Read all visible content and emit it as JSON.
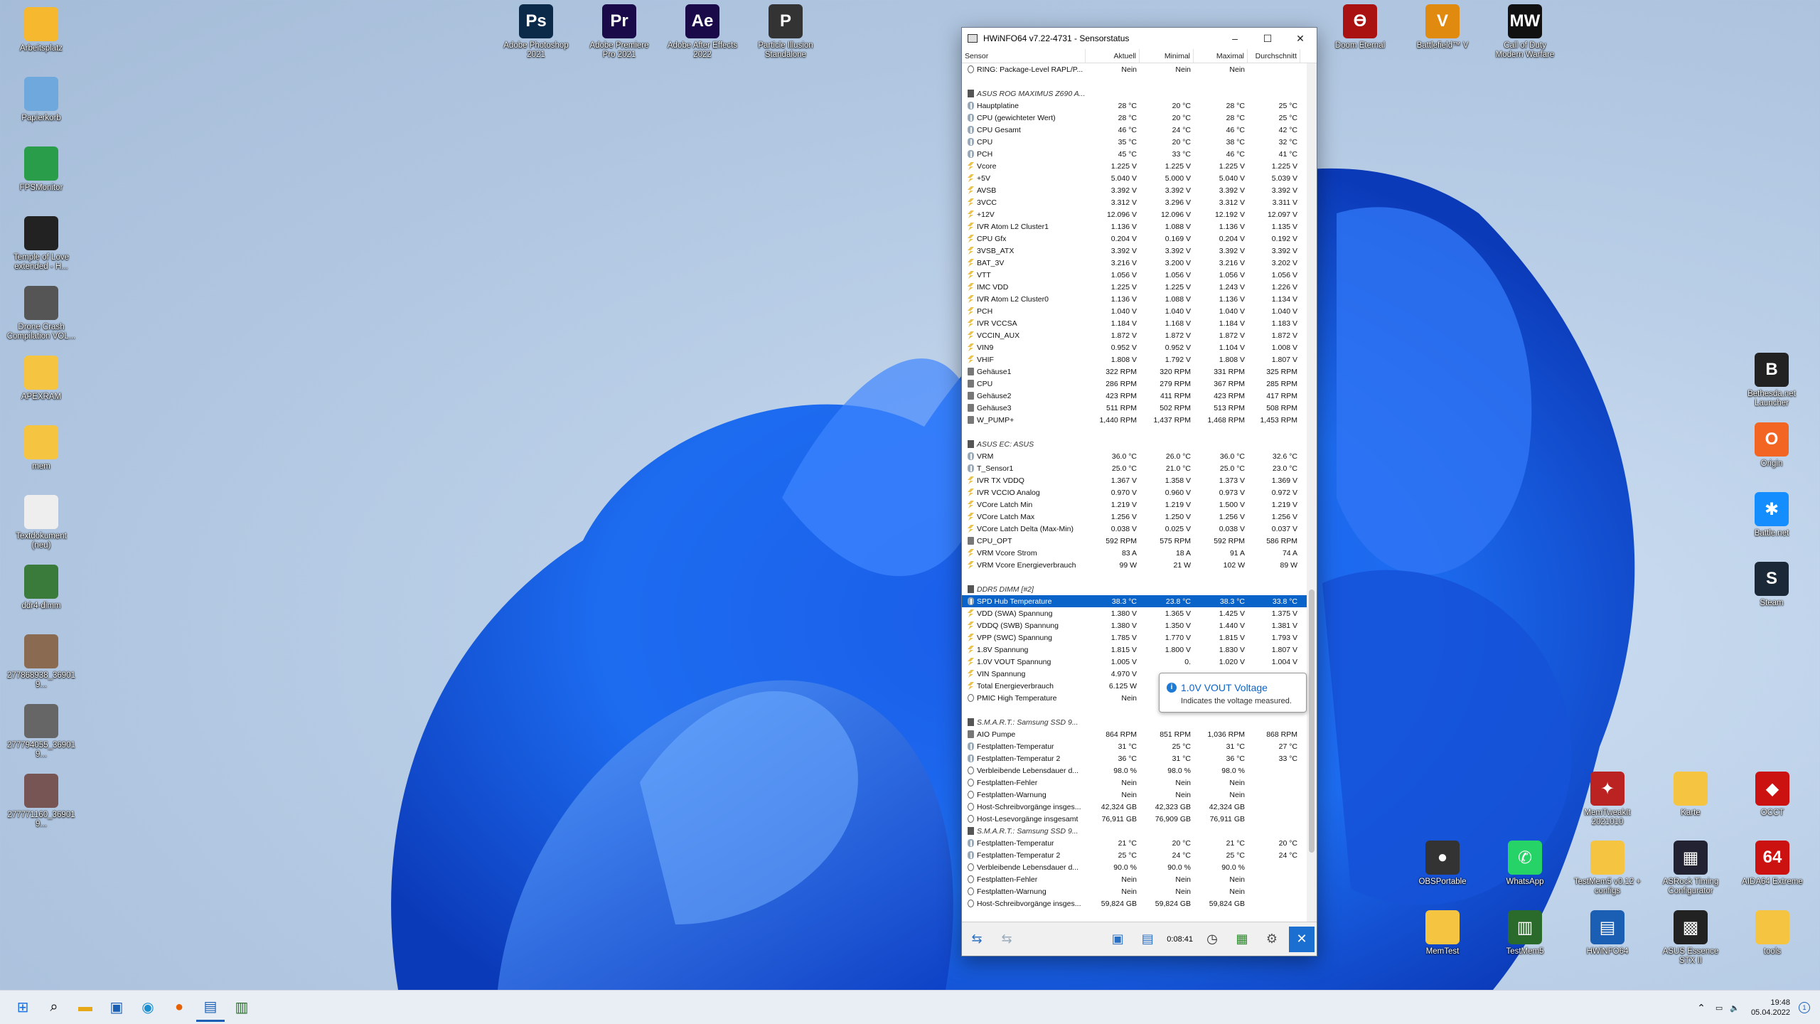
{
  "window": {
    "title": "HWiNFO64 v7.22-4731 - Sensorstatus",
    "minimize": "–",
    "maximize": "☐",
    "close": "✕"
  },
  "columns": [
    "Sensor",
    "Aktuell",
    "Minimal",
    "Maximal",
    "Durchschnitt"
  ],
  "rows": [
    {
      "ic": "o",
      "n": "RING: Package-Level RAPL/P...",
      "a": "Nein",
      "mi": "Nein",
      "ma": "Nein",
      "d": ""
    },
    {
      "ic": "",
      "n": "",
      "a": "",
      "mi": "",
      "ma": "",
      "d": ""
    },
    {
      "ic": "h",
      "n": "ASUS ROG MAXIMUS Z690 A...",
      "a": "",
      "mi": "",
      "ma": "",
      "d": "",
      "g": 1
    },
    {
      "ic": "t",
      "n": "Hauptplatine",
      "a": "28 °C",
      "mi": "20 °C",
      "ma": "28 °C",
      "d": "25 °C"
    },
    {
      "ic": "t",
      "n": "CPU (gewichteter Wert)",
      "a": "28 °C",
      "mi": "20 °C",
      "ma": "28 °C",
      "d": "25 °C"
    },
    {
      "ic": "t",
      "n": "CPU Gesamt",
      "a": "46 °C",
      "mi": "24 °C",
      "ma": "46 °C",
      "d": "42 °C"
    },
    {
      "ic": "t",
      "n": "CPU",
      "a": "35 °C",
      "mi": "20 °C",
      "ma": "38 °C",
      "d": "32 °C"
    },
    {
      "ic": "t",
      "n": "PCH",
      "a": "45 °C",
      "mi": "33 °C",
      "ma": "46 °C",
      "d": "41 °C"
    },
    {
      "ic": "vv",
      "n": "Vcore",
      "a": "1.225 V",
      "mi": "1.225 V",
      "ma": "1.225 V",
      "d": "1.225 V"
    },
    {
      "ic": "vv",
      "n": "+5V",
      "a": "5.040 V",
      "mi": "5.000 V",
      "ma": "5.040 V",
      "d": "5.039 V"
    },
    {
      "ic": "vv",
      "n": "AVSB",
      "a": "3.392 V",
      "mi": "3.392 V",
      "ma": "3.392 V",
      "d": "3.392 V"
    },
    {
      "ic": "vv",
      "n": "3VCC",
      "a": "3.312 V",
      "mi": "3.296 V",
      "ma": "3.312 V",
      "d": "3.311 V"
    },
    {
      "ic": "vv",
      "n": "+12V",
      "a": "12.096 V",
      "mi": "12.096 V",
      "ma": "12.192 V",
      "d": "12.097 V"
    },
    {
      "ic": "vv",
      "n": "IVR Atom L2 Cluster1",
      "a": "1.136 V",
      "mi": "1.088 V",
      "ma": "1.136 V",
      "d": "1.135 V"
    },
    {
      "ic": "vv",
      "n": "CPU Gfx",
      "a": "0.204 V",
      "mi": "0.169 V",
      "ma": "0.204 V",
      "d": "0.192 V"
    },
    {
      "ic": "vv",
      "n": "3VSB_ATX",
      "a": "3.392 V",
      "mi": "3.392 V",
      "ma": "3.392 V",
      "d": "3.392 V"
    },
    {
      "ic": "vv",
      "n": "BAT_3V",
      "a": "3.216 V",
      "mi": "3.200 V",
      "ma": "3.216 V",
      "d": "3.202 V"
    },
    {
      "ic": "vv",
      "n": "VTT",
      "a": "1.056 V",
      "mi": "1.056 V",
      "ma": "1.056 V",
      "d": "1.056 V"
    },
    {
      "ic": "vv",
      "n": "IMC VDD",
      "a": "1.225 V",
      "mi": "1.225 V",
      "ma": "1.243 V",
      "d": "1.226 V"
    },
    {
      "ic": "vv",
      "n": "IVR Atom L2 Cluster0",
      "a": "1.136 V",
      "mi": "1.088 V",
      "ma": "1.136 V",
      "d": "1.134 V"
    },
    {
      "ic": "vv",
      "n": "PCH",
      "a": "1.040 V",
      "mi": "1.040 V",
      "ma": "1.040 V",
      "d": "1.040 V"
    },
    {
      "ic": "vv",
      "n": "IVR VCCSA",
      "a": "1.184 V",
      "mi": "1.168 V",
      "ma": "1.184 V",
      "d": "1.183 V"
    },
    {
      "ic": "vv",
      "n": "VCCIN_AUX",
      "a": "1.872 V",
      "mi": "1.872 V",
      "ma": "1.872 V",
      "d": "1.872 V"
    },
    {
      "ic": "vv",
      "n": "VIN9",
      "a": "0.952 V",
      "mi": "0.952 V",
      "ma": "1.104 V",
      "d": "1.008 V"
    },
    {
      "ic": "vv",
      "n": "VHIF",
      "a": "1.808 V",
      "mi": "1.792 V",
      "ma": "1.808 V",
      "d": "1.807 V"
    },
    {
      "ic": "f",
      "n": "Gehäuse1",
      "a": "322 RPM",
      "mi": "320 RPM",
      "ma": "331 RPM",
      "d": "325 RPM"
    },
    {
      "ic": "f",
      "n": "CPU",
      "a": "286 RPM",
      "mi": "279 RPM",
      "ma": "367 RPM",
      "d": "285 RPM"
    },
    {
      "ic": "f",
      "n": "Gehäuse2",
      "a": "423 RPM",
      "mi": "411 RPM",
      "ma": "423 RPM",
      "d": "417 RPM"
    },
    {
      "ic": "f",
      "n": "Gehäuse3",
      "a": "511 RPM",
      "mi": "502 RPM",
      "ma": "513 RPM",
      "d": "508 RPM"
    },
    {
      "ic": "f",
      "n": "W_PUMP+",
      "a": "1,440 RPM",
      "mi": "1,437 RPM",
      "ma": "1,468 RPM",
      "d": "1,453 RPM"
    },
    {
      "ic": "",
      "n": "",
      "a": "",
      "mi": "",
      "ma": "",
      "d": ""
    },
    {
      "ic": "h",
      "n": "ASUS EC: ASUS",
      "a": "",
      "mi": "",
      "ma": "",
      "d": "",
      "g": 1
    },
    {
      "ic": "t",
      "n": "VRM",
      "a": "36.0 °C",
      "mi": "26.0 °C",
      "ma": "36.0 °C",
      "d": "32.6 °C"
    },
    {
      "ic": "t",
      "n": "T_Sensor1",
      "a": "25.0 °C",
      "mi": "21.0 °C",
      "ma": "25.0 °C",
      "d": "23.0 °C"
    },
    {
      "ic": "vv",
      "n": "IVR TX VDDQ",
      "a": "1.367 V",
      "mi": "1.358 V",
      "ma": "1.373 V",
      "d": "1.369 V"
    },
    {
      "ic": "vv",
      "n": "IVR VCCIO Analog",
      "a": "0.970 V",
      "mi": "0.960 V",
      "ma": "0.973 V",
      "d": "0.972 V"
    },
    {
      "ic": "vv",
      "n": "VCore Latch Min",
      "a": "1.219 V",
      "mi": "1.219 V",
      "ma": "1.500 V",
      "d": "1.219 V"
    },
    {
      "ic": "vv",
      "n": "VCore Latch Max",
      "a": "1.256 V",
      "mi": "1.250 V",
      "ma": "1.256 V",
      "d": "1.256 V"
    },
    {
      "ic": "vv",
      "n": "VCore Latch Delta (Max-Min)",
      "a": "0.038 V",
      "mi": "0.025 V",
      "ma": "0.038 V",
      "d": "0.037 V"
    },
    {
      "ic": "f",
      "n": "CPU_OPT",
      "a": "592 RPM",
      "mi": "575 RPM",
      "ma": "592 RPM",
      "d": "586 RPM"
    },
    {
      "ic": "vv",
      "n": "VRM Vcore Strom",
      "a": "83 A",
      "mi": "18 A",
      "ma": "91 A",
      "d": "74 A"
    },
    {
      "ic": "vv",
      "n": "VRM Vcore Energieverbrauch",
      "a": "99 W",
      "mi": "21 W",
      "ma": "102 W",
      "d": "89 W"
    },
    {
      "ic": "",
      "n": "",
      "a": "",
      "mi": "",
      "ma": "",
      "d": ""
    },
    {
      "ic": "h",
      "n": "DDR5 DIMM [#2]",
      "a": "",
      "mi": "",
      "ma": "",
      "d": "",
      "g": 1
    },
    {
      "ic": "t",
      "n": "SPD Hub Temperature",
      "a": "38.3 °C",
      "mi": "23.8 °C",
      "ma": "38.3 °C",
      "d": "33.8 °C",
      "s": 1
    },
    {
      "ic": "vv",
      "n": "VDD (SWA) Spannung",
      "a": "1.380 V",
      "mi": "1.365 V",
      "ma": "1.425 V",
      "d": "1.375 V"
    },
    {
      "ic": "vv",
      "n": "VDDQ (SWB) Spannung",
      "a": "1.380 V",
      "mi": "1.350 V",
      "ma": "1.440 V",
      "d": "1.381 V"
    },
    {
      "ic": "vv",
      "n": "VPP (SWC) Spannung",
      "a": "1.785 V",
      "mi": "1.770 V",
      "ma": "1.815 V",
      "d": "1.793 V"
    },
    {
      "ic": "vv",
      "n": "1.8V Spannung",
      "a": "1.815 V",
      "mi": "1.800 V",
      "ma": "1.830 V",
      "d": "1.807 V"
    },
    {
      "ic": "vv",
      "n": "1.0V VOUT Spannung",
      "a": "1.005 V",
      "mi": "0.",
      "ma": "1.020 V",
      "d": "1.004 V"
    },
    {
      "ic": "vv",
      "n": "VIN Spannung",
      "a": "4.970 V",
      "mi": "",
      "ma": "",
      "d": ""
    },
    {
      "ic": "vv",
      "n": "Total Energieverbrauch",
      "a": "6.125 W",
      "mi": "",
      "ma": "",
      "d": ""
    },
    {
      "ic": "o",
      "n": "PMIC High Temperature",
      "a": "Nein",
      "mi": "Nein",
      "ma": "",
      "d": ""
    },
    {
      "ic": "",
      "n": "",
      "a": "",
      "mi": "",
      "ma": "",
      "d": ""
    },
    {
      "ic": "h",
      "n": "S.M.A.R.T.: Samsung SSD 9...",
      "a": "",
      "mi": "",
      "ma": "",
      "d": "",
      "g": 1
    },
    {
      "ic": "f",
      "n": "AIO Pumpe",
      "a": "864 RPM",
      "mi": "851 RPM",
      "ma": "1,036 RPM",
      "d": "868 RPM"
    },
    {
      "ic": "t",
      "n": "Festplatten-Temperatur",
      "a": "31 °C",
      "mi": "25 °C",
      "ma": "31 °C",
      "d": "27 °C"
    },
    {
      "ic": "t",
      "n": "Festplatten-Temperatur 2",
      "a": "36 °C",
      "mi": "31 °C",
      "ma": "36 °C",
      "d": "33 °C"
    },
    {
      "ic": "o",
      "n": "Verbleibende Lebensdauer d...",
      "a": "98.0 %",
      "mi": "98.0 %",
      "ma": "98.0 %",
      "d": ""
    },
    {
      "ic": "o",
      "n": "Festplatten-Fehler",
      "a": "Nein",
      "mi": "Nein",
      "ma": "Nein",
      "d": ""
    },
    {
      "ic": "o",
      "n": "Festplatten-Warnung",
      "a": "Nein",
      "mi": "Nein",
      "ma": "Nein",
      "d": ""
    },
    {
      "ic": "o",
      "n": "Host-Schreibvorgänge insges...",
      "a": "42,324 GB",
      "mi": "42,323 GB",
      "ma": "42,324 GB",
      "d": ""
    },
    {
      "ic": "o",
      "n": "Host-Lesevorgänge insgesamt",
      "a": "76,911 GB",
      "mi": "76,909 GB",
      "ma": "76,911 GB",
      "d": ""
    },
    {
      "ic": "h",
      "n": "S.M.A.R.T.: Samsung SSD 9...",
      "a": "",
      "mi": "",
      "ma": "",
      "d": "",
      "g": 1
    },
    {
      "ic": "t",
      "n": "Festplatten-Temperatur",
      "a": "21 °C",
      "mi": "20 °C",
      "ma": "21 °C",
      "d": "20 °C"
    },
    {
      "ic": "t",
      "n": "Festplatten-Temperatur 2",
      "a": "25 °C",
      "mi": "24 °C",
      "ma": "25 °C",
      "d": "24 °C"
    },
    {
      "ic": "o",
      "n": "Verbleibende Lebensdauer d...",
      "a": "90.0 %",
      "mi": "90.0 %",
      "ma": "90.0 %",
      "d": ""
    },
    {
      "ic": "o",
      "n": "Festplatten-Fehler",
      "a": "Nein",
      "mi": "Nein",
      "ma": "Nein",
      "d": ""
    },
    {
      "ic": "o",
      "n": "Festplatten-Warnung",
      "a": "Nein",
      "mi": "Nein",
      "ma": "Nein",
      "d": ""
    },
    {
      "ic": "o",
      "n": "Host-Schreibvorgänge insges...",
      "a": "59,824 GB",
      "mi": "59,824 GB",
      "ma": "59,824 GB",
      "d": ""
    }
  ],
  "tooltip": {
    "title": "1.0V VOUT Voltage",
    "desc": "Indicates the voltage measured."
  },
  "toolbar": {
    "timer": "0:08:41"
  },
  "desktop_left": [
    {
      "label": "Arbeitsplatz",
      "color": "#f5b82e"
    },
    {
      "label": "Papierkorb",
      "color": "#6fa8dc"
    },
    {
      "label": "FPSMonitor",
      "color": "#2a9d4a"
    },
    {
      "label": "Temple of Love extended - H...",
      "color": "#222"
    },
    {
      "label": "Drone Crash Compilation VOL...",
      "color": "#555"
    },
    {
      "label": "APEXRAM",
      "color": "#f5c542"
    },
    {
      "label": "mem",
      "color": "#f5c542"
    },
    {
      "label": "Textdokument (neu)",
      "color": "#eee"
    },
    {
      "label": "ddr4-dimm",
      "color": "#3a7a3a"
    },
    {
      "label": "277868938_369019...",
      "color": "#8a6a50"
    },
    {
      "label": "277794055_369019...",
      "color": "#666"
    },
    {
      "label": "277771160_369019...",
      "color": "#755"
    }
  ],
  "desktop_top": [
    {
      "label": "Adobe Photoshop 2021",
      "glyph": "Ps",
      "color": "#0b2a4a"
    },
    {
      "label": "Adobe Premiere Pro 2021",
      "glyph": "Pr",
      "color": "#1a0a4a"
    },
    {
      "label": "Adobe After Effects 2022",
      "glyph": "Ae",
      "color": "#1a0a4a"
    },
    {
      "label": "Particle Illusion Standalone",
      "glyph": "P",
      "color": "#333"
    }
  ],
  "desktop_topright": [
    {
      "label": "Doom Eternal",
      "glyph": "Ɵ",
      "color": "#a11"
    },
    {
      "label": "Battlefield™ V",
      "glyph": "V",
      "color": "#e08a10"
    },
    {
      "label": "Call of Duty Modern Warfare",
      "glyph": "MW",
      "color": "#111"
    }
  ],
  "desktop_right": [
    {
      "label": "Bethesda.net Launcher",
      "glyph": "B",
      "color": "#222"
    },
    {
      "label": "Origin",
      "glyph": "O",
      "color": "#f26522"
    },
    {
      "label": "Battle.net",
      "glyph": "✱",
      "color": "#148eff"
    },
    {
      "label": "Steam",
      "glyph": "S",
      "color": "#1b2838"
    }
  ],
  "desktop_bottomright": [
    {
      "label": "OBSPortable",
      "glyph": "●",
      "color": "#333"
    },
    {
      "label": "WhatsApp",
      "glyph": "✆",
      "color": "#25d366"
    },
    {
      "label": "TestMem5 v0.12 + configs",
      "glyph": "",
      "color": "#f5c542"
    },
    {
      "label": "ASRock Timing Configurator",
      "glyph": "▦",
      "color": "#223"
    },
    {
      "label": "AIDA64 Extreme",
      "glyph": "64",
      "color": "#c11"
    },
    {
      "label": "MemTest",
      "glyph": "",
      "color": "#f5c542"
    },
    {
      "label": "TestMem5",
      "glyph": "▥",
      "color": "#2a6a2a"
    },
    {
      "label": "HWiNFO64",
      "glyph": "▤",
      "color": "#1a5fb4"
    },
    {
      "label": "ASUS Essence STX II",
      "glyph": "▩",
      "color": "#222"
    },
    {
      "label": "tools",
      "glyph": "",
      "color": "#f5c542"
    },
    {
      "label": "MemTweakIt 2021010",
      "glyph": "✦",
      "color": "#b22"
    },
    {
      "label": "Karte",
      "glyph": "",
      "color": "#f5c542"
    },
    {
      "label": "OCCT",
      "glyph": "◆",
      "color": "#c11"
    }
  ],
  "tray": {
    "time": "19:48",
    "date": "05.04.2022",
    "notif": "1"
  }
}
